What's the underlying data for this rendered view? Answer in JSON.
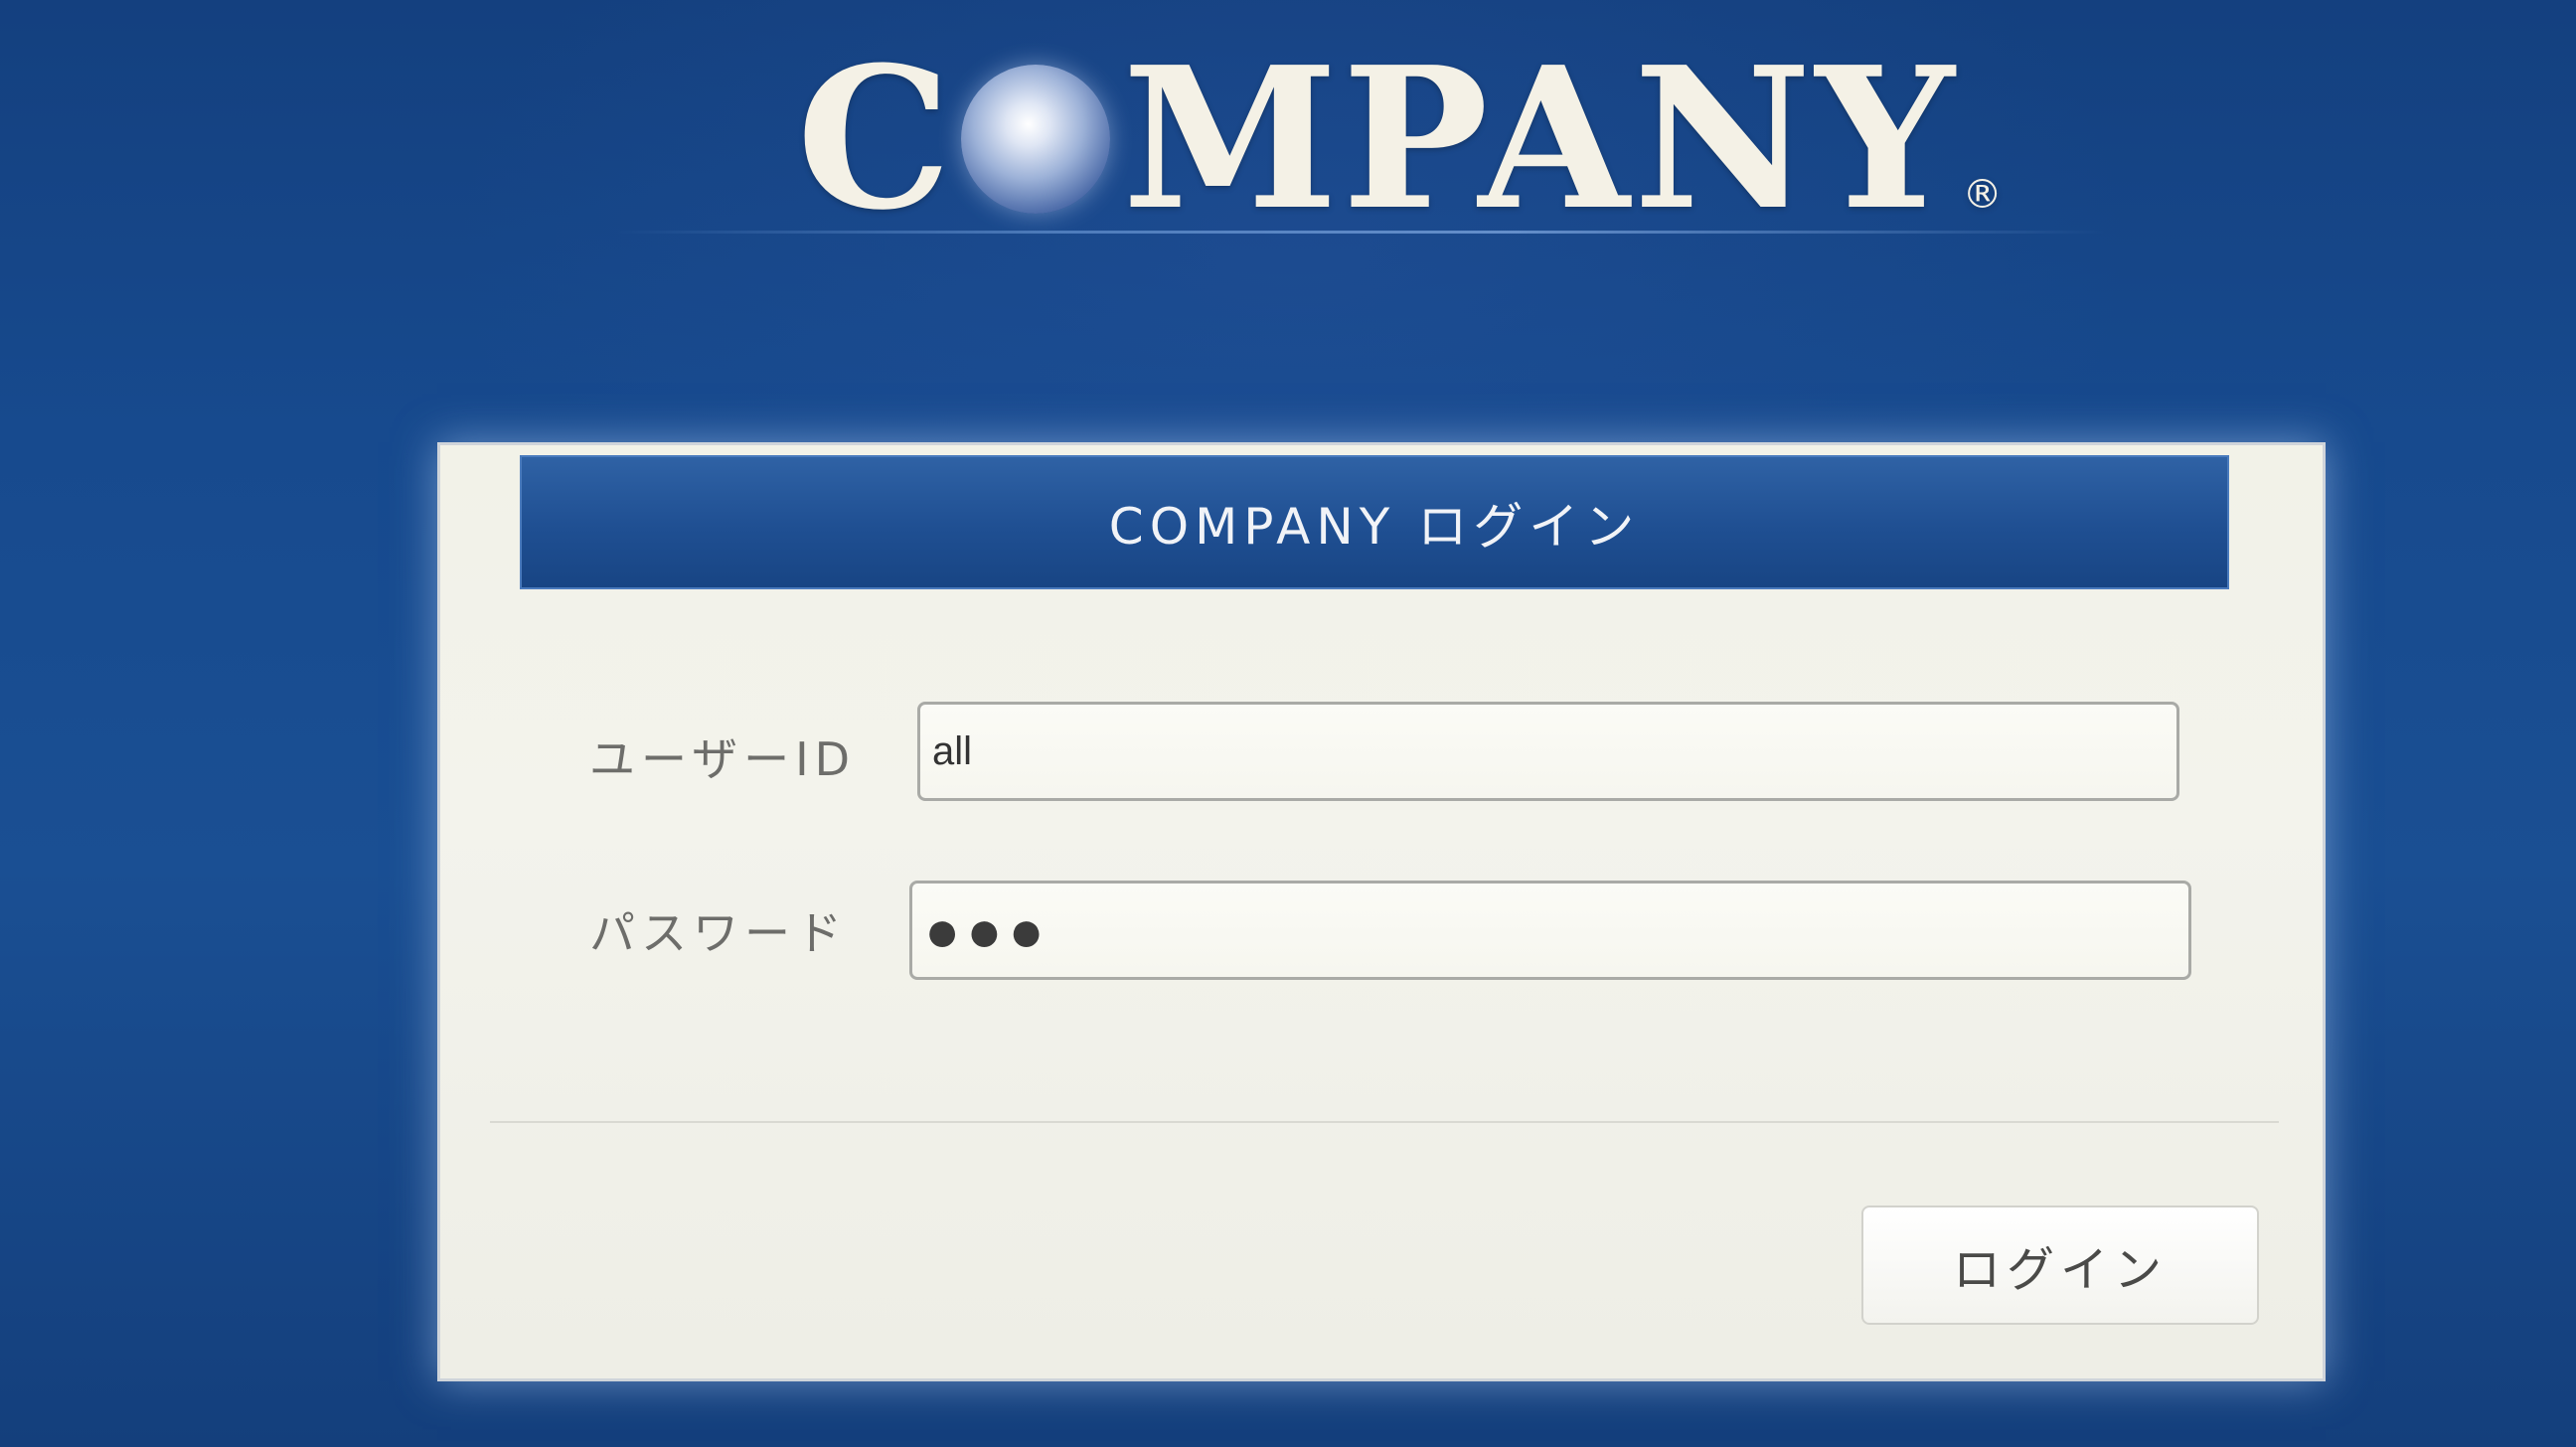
{
  "logo": {
    "before_sphere": "C",
    "after_sphere": "MPANY",
    "registered_mark": "®"
  },
  "dialog": {
    "title": "COMPANY ログイン",
    "fields": {
      "user_id": {
        "label": "ユーザーID",
        "value": "all"
      },
      "password": {
        "label": "パスワード",
        "masked_value": "●●●"
      }
    },
    "login_button": "ログイン"
  },
  "colors": {
    "background": "#174a8e",
    "header": "#1f4f92",
    "dialog_body": "#f2f2e8",
    "logo_text": "#f4f1e6"
  }
}
